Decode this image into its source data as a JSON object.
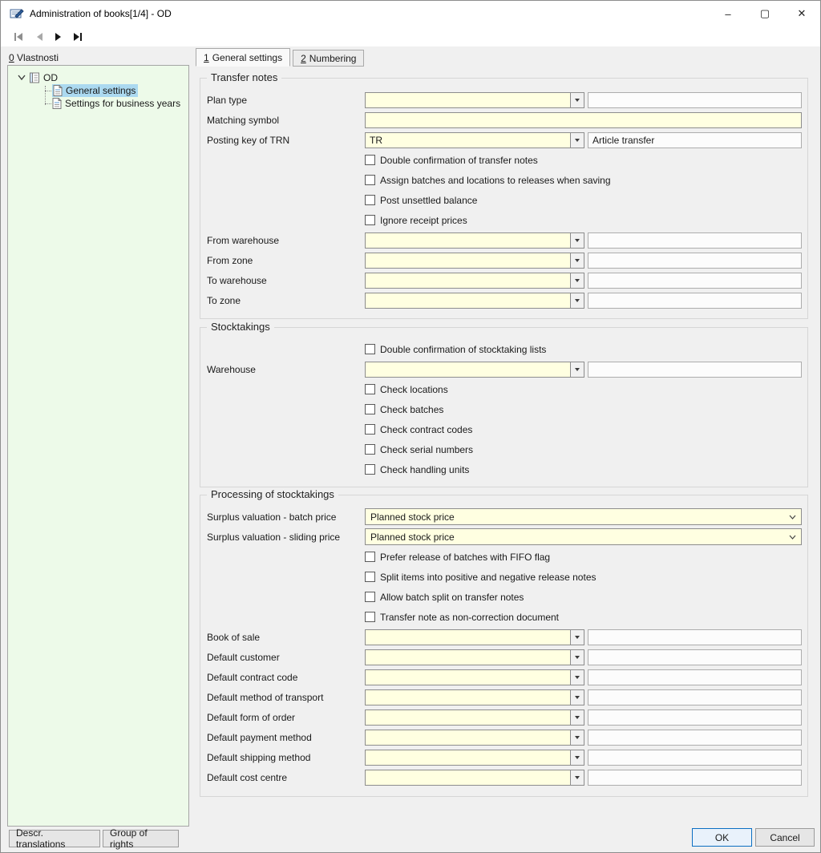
{
  "window": {
    "title": "Administration of books[1/4] - OD",
    "minimize": "–",
    "maximize": "▢",
    "close": "✕"
  },
  "toolbar": {
    "nav_icons": [
      "first-record-icon",
      "previous-record-icon",
      "next-record-icon",
      "last-record-icon"
    ]
  },
  "sidebar": {
    "header_accel": "0",
    "header_label": " Vlastnosti",
    "tree_root": "OD",
    "tree_items": [
      {
        "label": "General settings",
        "selected": true
      },
      {
        "label": "Settings for business years",
        "selected": false
      }
    ],
    "footer_buttons": {
      "translations": "Descr. translations",
      "rights": "Group of rights"
    }
  },
  "tabs": {
    "general": {
      "num": "1",
      "label": "General settings",
      "active": true
    },
    "numbering": {
      "num": "2",
      "label": "Numbering",
      "active": false
    }
  },
  "group_titles": {
    "transfer": "Transfer notes",
    "stocktakings": "Stocktakings",
    "processing": "Processing of stocktakings"
  },
  "fields": {
    "plan_type": {
      "label": "Plan type",
      "value": "",
      "paired": ""
    },
    "matching_symbol": {
      "label": "Matching symbol",
      "value": ""
    },
    "posting_key_trn": {
      "label": "Posting key of TRN",
      "value": "TR",
      "paired": "Article transfer"
    },
    "from_warehouse": {
      "label": "From warehouse",
      "value": "",
      "paired": ""
    },
    "from_zone": {
      "label": "From zone",
      "value": "",
      "paired": ""
    },
    "to_warehouse": {
      "label": "To warehouse",
      "value": "",
      "paired": ""
    },
    "to_zone": {
      "label": "To zone",
      "value": "",
      "paired": ""
    },
    "warehouse": {
      "label": "Warehouse",
      "value": "",
      "paired": ""
    },
    "surplus_batch": {
      "label": "Surplus valuation - batch price",
      "value": "Planned stock price"
    },
    "surplus_sliding": {
      "label": "Surplus valuation - sliding price",
      "value": "Planned stock price"
    },
    "book_of_sale": {
      "label": "Book of sale",
      "value": "",
      "paired": ""
    },
    "default_customer": {
      "label": "Default customer",
      "value": "",
      "paired": ""
    },
    "default_contract": {
      "label": "Default contract code",
      "value": "",
      "paired": ""
    },
    "default_transport": {
      "label": "Default method of transport",
      "value": "",
      "paired": ""
    },
    "default_order": {
      "label": "Default form of order",
      "value": "",
      "paired": ""
    },
    "default_payment": {
      "label": "Default payment method",
      "value": "",
      "paired": ""
    },
    "default_shipping": {
      "label": "Default shipping method",
      "value": "",
      "paired": ""
    },
    "default_cost": {
      "label": "Default cost centre",
      "value": "",
      "paired": ""
    }
  },
  "checkboxes": {
    "double_confirm_trn": "Double confirmation of transfer notes",
    "assign_batches": "Assign batches and locations to releases when saving",
    "post_unsettled": "Post unsettled balance",
    "ignore_receipt": "Ignore receipt prices",
    "double_confirm_stocktaking": "Double confirmation of stocktaking lists",
    "check_locations": "Check locations",
    "check_batches": "Check batches",
    "check_contract_codes": "Check contract codes",
    "check_serial_numbers": "Check serial numbers",
    "check_handling_units": "Check handling units",
    "prefer_fifo": "Prefer release of batches with FIFO flag",
    "split_items": "Split items into positive and negative release notes",
    "allow_batch_split": "Allow batch split on transfer notes",
    "transfer_note_noncorrection": "Transfer note as non-correction document"
  },
  "actions": {
    "ok": "OK",
    "cancel": "Cancel"
  },
  "colors": {
    "field_yellow": "#ffffe1",
    "selection_blue": "#abd9f0",
    "accent_blue": "#0b6fc2",
    "tree_bg": "#edfae9"
  }
}
